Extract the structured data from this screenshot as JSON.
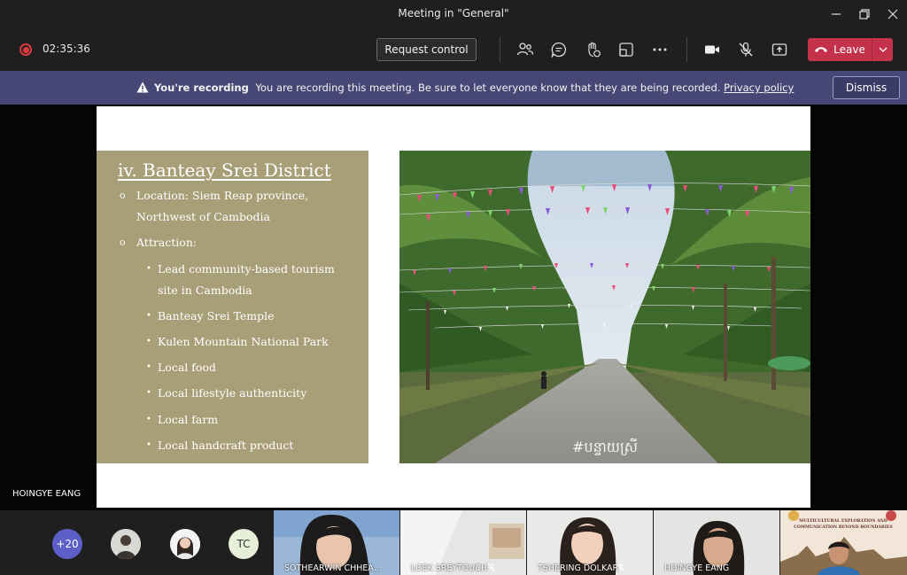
{
  "window": {
    "title": "Meeting in \"General\""
  },
  "toolbar": {
    "timer": "02:35:36",
    "request_control": "Request control",
    "leave": "Leave"
  },
  "banner": {
    "heading": "You're recording",
    "message": "You are recording this meeting. Be sure to let everyone know that they are being recorded.",
    "privacy_link": "Privacy policy",
    "dismiss": "Dismiss"
  },
  "slide": {
    "title": "iv. Banteay Srei District",
    "bullets": [
      {
        "marker": "o",
        "text": "Location: Siem Reap province, Northwest of Cambodia"
      },
      {
        "marker": "o",
        "text": "Attraction:"
      }
    ],
    "sub_marker": "•",
    "sub_bullets": [
      "Lead community-based tourism site in Cambodia",
      "Banteay Srei Temple",
      "Kulen Mountain National Park",
      "Local food",
      "Local lifestyle authenticity",
      "Local farm",
      "Local handcraft product"
    ],
    "photo_tag": "#បន្ទាយស្រី"
  },
  "presenter": {
    "name": "HOINGYE EANG"
  },
  "gallery": {
    "overflow_count": "+20",
    "avatar_initials": "TC",
    "tiles": [
      {
        "name": "SOTHEARWIN CHHEA..."
      },
      {
        "name": "LOEK SREYTOUCH"
      },
      {
        "name": "TSHERING DOLKAR"
      },
      {
        "name": "HOINGYE EANG"
      }
    ],
    "last_tile": {
      "line1": "MULTICULTURAL EXPLORATION AND",
      "line2": "COMMUNICATION BEYOND BOUNDARIES"
    }
  }
}
